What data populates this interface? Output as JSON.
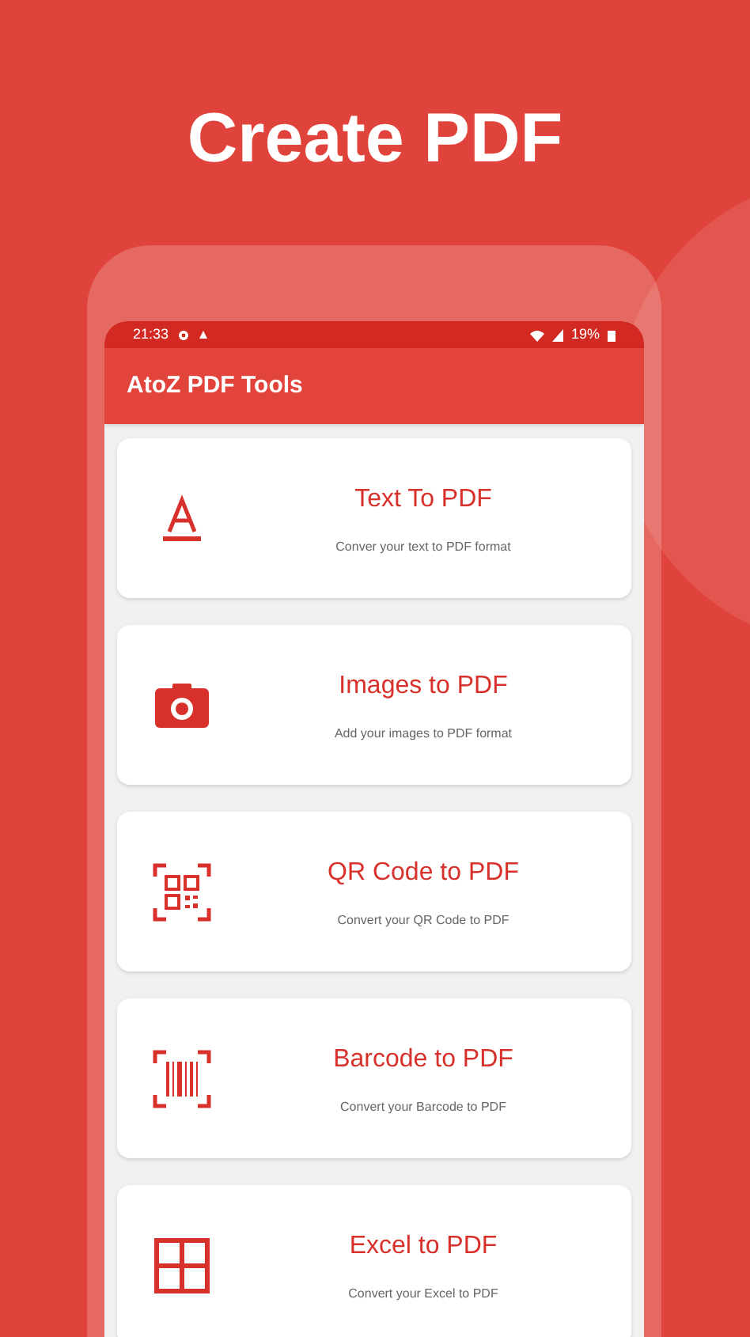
{
  "headline": "Create PDF",
  "status_bar": {
    "time": "21:33",
    "battery": "19%"
  },
  "app_bar": {
    "title": "AtoZ PDF Tools"
  },
  "tools": [
    {
      "kind": "text",
      "title": "Text To PDF",
      "subtitle": "Conver your text to PDF format"
    },
    {
      "kind": "camera",
      "title": "Images to PDF",
      "subtitle": "Add your images to PDF format"
    },
    {
      "kind": "qr",
      "title": "QR Code to PDF",
      "subtitle": "Convert your QR Code to PDF"
    },
    {
      "kind": "barcode",
      "title": "Barcode to PDF",
      "subtitle": "Convert your Barcode to PDF"
    },
    {
      "kind": "grid",
      "title": "Excel to PDF",
      "subtitle": "Convert your Excel to PDF"
    }
  ]
}
